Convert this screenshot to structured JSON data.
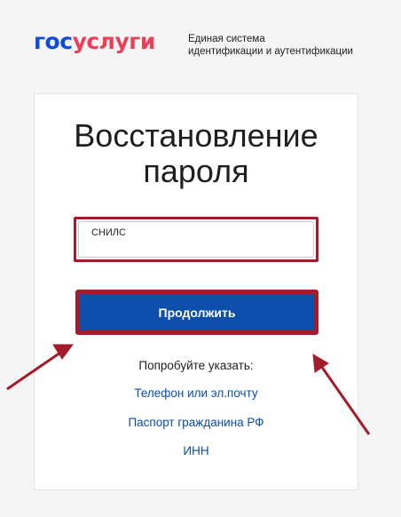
{
  "logo": {
    "gos": "гос",
    "uslugi": "услуги"
  },
  "tagline": {
    "line1": "Единая система",
    "line2": "идентификации и аутентификации"
  },
  "page": {
    "title_line1": "Восстановление",
    "title_line2": "пароля"
  },
  "form": {
    "snils_label": "СНИЛС",
    "snils_value": "",
    "continue_label": "Продолжить"
  },
  "alternatives": {
    "hint": "Попробуйте указать:",
    "phone_email": "Телефон или эл.почту",
    "passport": "Паспорт гражданина РФ",
    "inn": "ИНН"
  },
  "colors": {
    "brand_blue": "#0d4cd3",
    "brand_red": "#ee3f58",
    "button_blue": "#0b4eac",
    "highlight_red": "#a31c2b"
  }
}
